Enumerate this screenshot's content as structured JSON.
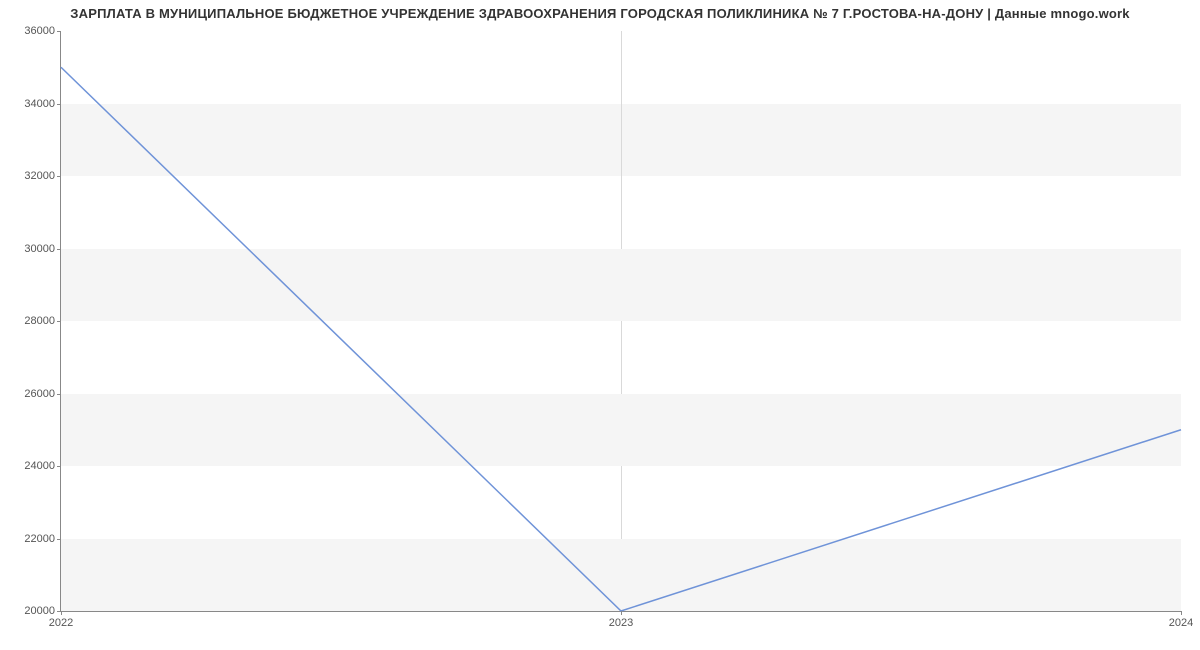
{
  "chart_data": {
    "type": "line",
    "title": "ЗАРПЛАТА В МУНИЦИПАЛЬНОЕ БЮДЖЕТНОЕ УЧРЕЖДЕНИЕ ЗДРАВООХРАНЕНИЯ  ГОРОДСКАЯ ПОЛИКЛИНИКА № 7 Г.РОСТОВА-НА-ДОНУ | Данные mnogo.work",
    "x": [
      2022,
      2023,
      2024
    ],
    "values": [
      35000,
      20000,
      25000
    ],
    "x_ticks": [
      2022,
      2023,
      2024
    ],
    "y_ticks": [
      20000,
      22000,
      24000,
      26000,
      28000,
      30000,
      32000,
      34000,
      36000
    ],
    "xlim": [
      2022,
      2024
    ],
    "ylim": [
      20000,
      36000
    ],
    "line_color": "#6f93d8"
  }
}
